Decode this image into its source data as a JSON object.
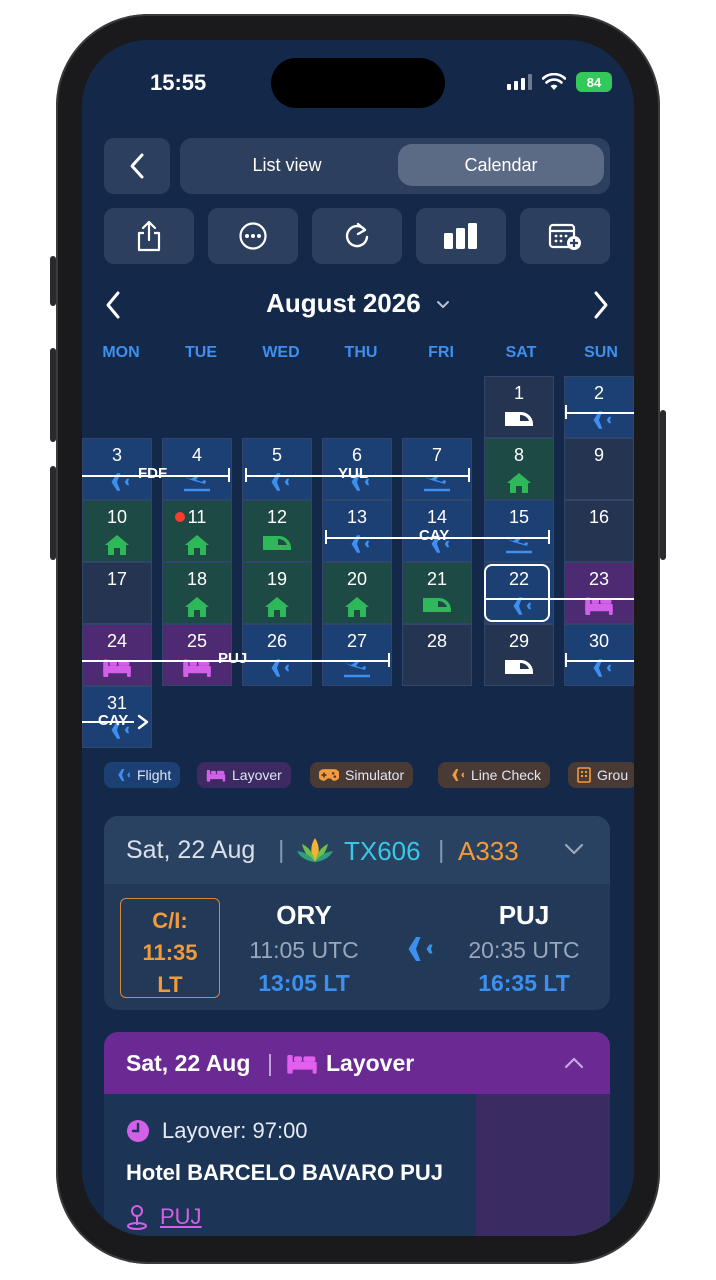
{
  "status": {
    "time": "15:55",
    "battery": "84"
  },
  "topbar": {
    "list_label": "List view",
    "calendar_label": "Calendar"
  },
  "calendar": {
    "month": "August 2026",
    "weekdays": [
      "MON",
      "TUE",
      "WED",
      "THU",
      "FRI",
      "SAT",
      "SUN"
    ],
    "routes": {
      "fdf": "FDF",
      "yul": "YUL",
      "cay1": "CAY",
      "puj": "PUJ",
      "cay2": "CAY"
    }
  },
  "legend": {
    "flight": "Flight",
    "layover": "Layover",
    "simulator": "Simulator",
    "line_check": "Line Check",
    "ground": "Grou"
  },
  "colors": {
    "flight": "#3d8ff0",
    "home": "#2fb85a",
    "hotel": "#d45fe8",
    "accent_orange": "#f39a3a",
    "accent_cyan": "#38c8e6"
  },
  "flight_card": {
    "date": "Sat, 22 Aug",
    "flight_no": "TX606",
    "aircraft": "A333",
    "checkin_label": "C/I:",
    "checkin_time": "11:35",
    "checkin_tz": "LT",
    "dep": {
      "code": "ORY",
      "utc": "11:05 UTC",
      "lt": "13:05 LT"
    },
    "arr": {
      "code": "PUJ",
      "utc": "20:35 UTC",
      "lt": "16:35 LT"
    }
  },
  "layover_card": {
    "date": "Sat, 22 Aug",
    "title": "Layover",
    "duration": "Layover: 97:00",
    "hotel": "Hotel BARCELO BAVARO PUJ",
    "location": "PUJ"
  }
}
